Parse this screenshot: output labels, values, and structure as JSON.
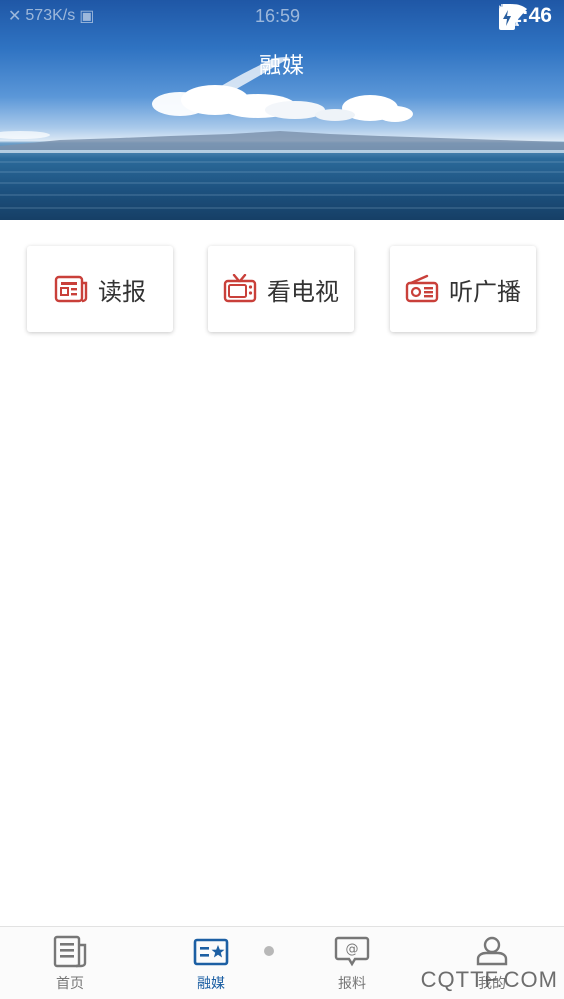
{
  "status_bar": {
    "net_speed": "573K/s",
    "overlay_time": "16:59",
    "time": "11:46",
    "icons": [
      "close-icon",
      "image-icon",
      "wifi-icon",
      "no-sim-icon",
      "battery-charging-icon"
    ]
  },
  "header": {
    "title": "融媒"
  },
  "cards": [
    {
      "label": "读报",
      "icon": "newspaper-icon"
    },
    {
      "label": "看电视",
      "icon": "tv-icon"
    },
    {
      "label": "听广播",
      "icon": "radio-icon"
    }
  ],
  "bottom_nav": {
    "items": [
      {
        "label": "首页",
        "icon": "news-doc-icon",
        "active": false
      },
      {
        "label": "融媒",
        "icon": "media-star-icon",
        "active": true
      },
      {
        "label": "报料",
        "icon": "at-message-icon",
        "active": false
      },
      {
        "label": "我的",
        "icon": "user-icon",
        "active": false
      }
    ]
  },
  "watermark": "CQTTF.COM",
  "colors": {
    "accent": "#1c5fa3",
    "card_icon": "#c9403a",
    "inactive_nav": "#777777"
  }
}
